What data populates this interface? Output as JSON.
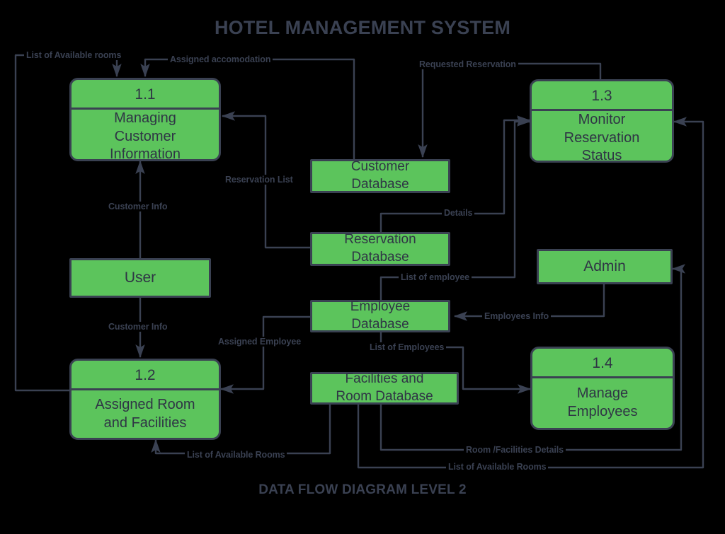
{
  "diagram": {
    "title": "HOTEL MANAGEMENT SYSTEM",
    "subtitle": "DATA FLOW DIAGRAM LEVEL 2",
    "type": "data-flow-diagram",
    "colors": {
      "background": "#000000",
      "node_fill": "#5cc45c",
      "node_border": "#3a4152",
      "text": "#2f3545",
      "flow_line": "#3a4152",
      "title_text": "#3a4152"
    }
  },
  "processes": [
    {
      "id": "p11",
      "number": "1.1",
      "name": "Managing\nCustomer\nInformation",
      "line1": "Managing",
      "line2": "Customer",
      "line3": "Information"
    },
    {
      "id": "p12",
      "number": "1.2",
      "name": "Assigned Room\nand Facilities",
      "line1": "Assigned Room",
      "line2": "and Facilities"
    },
    {
      "id": "p13",
      "number": "1.3",
      "name": "Monitor\nReservation\nStatus",
      "line1": "Monitor",
      "line2": "Reservation",
      "line3": "Status"
    },
    {
      "id": "p14",
      "number": "1.4",
      "name": "Manage\nEmployees",
      "line1": "Manage",
      "line2": "Employees"
    }
  ],
  "datastores": [
    {
      "id": "ds_customer",
      "line1": "Customer",
      "line2": "Database"
    },
    {
      "id": "ds_reservation",
      "line1": "Reservation",
      "line2": "Database"
    },
    {
      "id": "ds_employee",
      "line1": "Employee",
      "line2": "Database"
    },
    {
      "id": "ds_facilities",
      "line1": "Facilities and",
      "line2": "Room Database"
    }
  ],
  "entities": [
    {
      "id": "e_user",
      "label": "User"
    },
    {
      "id": "e_admin",
      "label": "Admin"
    }
  ],
  "flows": [
    {
      "id": "f1",
      "label": "List of Available rooms",
      "from": "1.2",
      "to": "1.1"
    },
    {
      "id": "f2",
      "label": "Assigned accomodation",
      "from": "Customer Database",
      "to": "1.1"
    },
    {
      "id": "f3",
      "label": "Requested Reservation",
      "from": "1.3",
      "to": "Customer Database"
    },
    {
      "id": "f4",
      "label": "Reservation List",
      "from": "Reservation Database",
      "to": "1.1"
    },
    {
      "id": "f5",
      "label": "Details",
      "from": "Reservation Database",
      "to": "1.3"
    },
    {
      "id": "f6",
      "label": "Customer Info",
      "from": "User",
      "to": "1.1"
    },
    {
      "id": "f7",
      "label": "Customer Info",
      "from": "User",
      "to": "1.2"
    },
    {
      "id": "f8",
      "label": "List of employee",
      "from": "Employee Database",
      "to": "1.3"
    },
    {
      "id": "f9",
      "label": "Employees Info",
      "from": "Admin",
      "to": "Employee Database"
    },
    {
      "id": "f10",
      "label": "Assigned Employee",
      "from": "Employee Database",
      "to": "1.2"
    },
    {
      "id": "f11",
      "label": "List of Employees",
      "from": "Employee Database",
      "to": "1.4"
    },
    {
      "id": "f12",
      "label": "List of Available Rooms",
      "from": "Facilities and Room Database",
      "to": "1.2"
    },
    {
      "id": "f13",
      "label": "Room /Facilities Details",
      "from": "Facilities and Room Database",
      "to": "Admin"
    },
    {
      "id": "f14",
      "label": "List of Available Rooms",
      "from": "Facilities and Room Database",
      "to": "1.3"
    }
  ]
}
